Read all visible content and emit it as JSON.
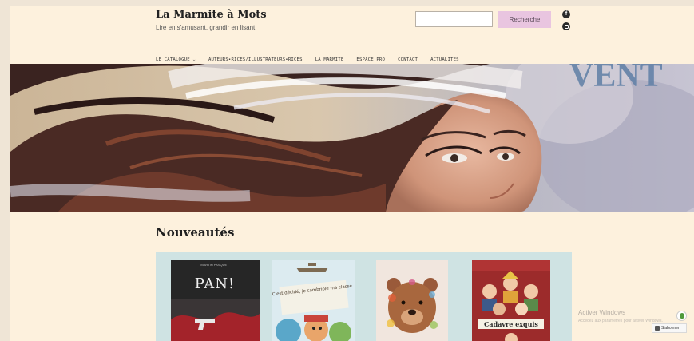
{
  "site": {
    "title": "La Marmite à Mots",
    "tagline": "Lire en s'amusant, grandir en lisant."
  },
  "search": {
    "placeholder": "",
    "button_label": "Recherche"
  },
  "social": {
    "facebook_label": "f",
    "icons": [
      "facebook-icon",
      "instagram-icon"
    ]
  },
  "nav": {
    "items": [
      "LE CATALOGUE ⌄",
      "AUTEURS•RICES/ILLUSTRATEURS•RICES",
      "LA MARMITE",
      "ESPACE PRO",
      "CONTACT",
      "ACTUALITÉS"
    ]
  },
  "hero": {
    "overlay_text": "VENT"
  },
  "nouveautes": {
    "title": "Nouveautés",
    "books": [
      {
        "title": "PAN!",
        "author": "MARTIN PASQUET"
      },
      {
        "title": "C'est décidé, je cambriole ma classe",
        "author": ""
      },
      {
        "title": "",
        "author": ""
      },
      {
        "title": "Cadavre exquis",
        "author": ""
      }
    ]
  },
  "windows_watermark": {
    "title": "Activer Windows",
    "subtitle": "Accédez aux paramètres pour activer Windows."
  },
  "follow": {
    "label": "S'abonner"
  },
  "colors": {
    "page_background": "#fdf1dd",
    "outer_background": "#efe5d6",
    "search_button": "#e9c5e0",
    "books_panel": "#cfe3e3"
  }
}
